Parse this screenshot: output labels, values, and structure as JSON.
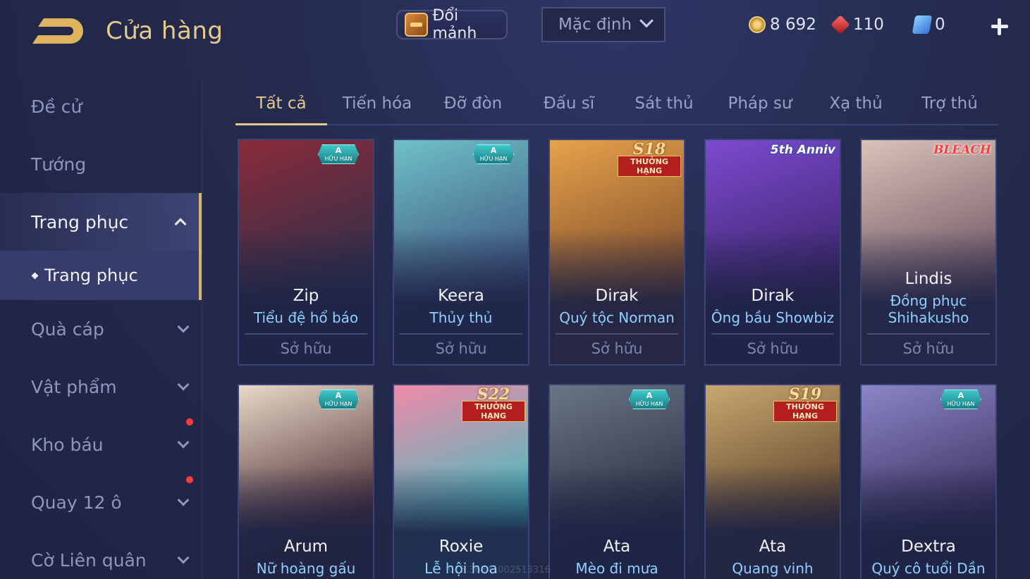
{
  "header": {
    "title": "Cửa hàng",
    "fragment_button": "Đổi mảnh",
    "sort": {
      "selected": "Mặc định"
    },
    "currencies": [
      {
        "icon": "gold-coin-icon",
        "value": "8 692"
      },
      {
        "icon": "ruby-icon",
        "value": "110"
      },
      {
        "icon": "voucher-icon",
        "value": "0"
      }
    ]
  },
  "sidebar": {
    "items": [
      {
        "label": "Đề cử"
      },
      {
        "label": "Tướng"
      },
      {
        "label": "Trang phục",
        "expanded": true
      },
      {
        "label": "Quà cáp"
      },
      {
        "label": "Vật phẩm"
      },
      {
        "label": "Kho báu",
        "notification": true
      },
      {
        "label": "Quay 12 ô",
        "notification": true
      },
      {
        "label": "Cờ Liên quân"
      }
    ],
    "sub_item": "Trang phục"
  },
  "tabs": [
    "Tất cả",
    "Tiến hóa",
    "Đỡ đòn",
    "Đấu sĩ",
    "Sát thủ",
    "Pháp sư",
    "Xạ thủ",
    "Trợ thủ"
  ],
  "active_tab": "Tất cả",
  "badges": {
    "limited": {
      "grade": "A",
      "text": "HỮU HẠN"
    },
    "ranked": "THƯỞNG HẠNG"
  },
  "cards_row1": [
    {
      "hero": "Zip",
      "skin": "Tiểu đệ hổ báo",
      "status": "Sở hữu",
      "badge": "A",
      "colors": [
        "#8a2b3a",
        "#2b2f4a"
      ]
    },
    {
      "hero": "Keera",
      "skin": "Thủy thủ",
      "status": "Sở hữu",
      "badge": "A",
      "colors": [
        "#6fc1c8",
        "#3b4f7a"
      ]
    },
    {
      "hero": "Dirak",
      "skin": "Quý tộc Norman",
      "status": "Sở hữu",
      "badge": "S18",
      "colors": [
        "#e7a24a",
        "#7a4a2a"
      ]
    },
    {
      "hero": "Dirak",
      "skin": "Ông bầu Showbiz",
      "status": "Sở hữu",
      "badge": "5th Anniv",
      "colors": [
        "#7d4ad0",
        "#3a2468"
      ]
    },
    {
      "hero": "Lindis",
      "skin": "Đồng phục Shihakusho",
      "status": "Sở hữu",
      "badge": "BLEACH",
      "colors": [
        "#d9c3b8",
        "#6a5060"
      ]
    }
  ],
  "cards_row2": [
    {
      "hero": "Arum",
      "skin": "Nữ hoàng gấu xám",
      "badge": "A",
      "colors": [
        "#e8d9c8",
        "#4a2a30"
      ]
    },
    {
      "hero": "Roxie",
      "skin": "Lễ hội hoa",
      "badge": "S22",
      "colors": [
        "#f08aa8",
        "#3fbfc0"
      ]
    },
    {
      "hero": "Ata",
      "skin": "Mèo đi mưa",
      "badge": "A",
      "colors": [
        "#6a7588",
        "#2a3040"
      ]
    },
    {
      "hero": "Ata",
      "skin": "Quang vinh",
      "badge": "S19",
      "colors": [
        "#c8a870",
        "#5a4028"
      ]
    },
    {
      "hero": "Dextra",
      "skin": "Quý cô tuổi Dần",
      "badge": "A",
      "colors": [
        "#8a86c8",
        "#3a2e5a"
      ]
    }
  ],
  "watermark": "015.36841002513316"
}
